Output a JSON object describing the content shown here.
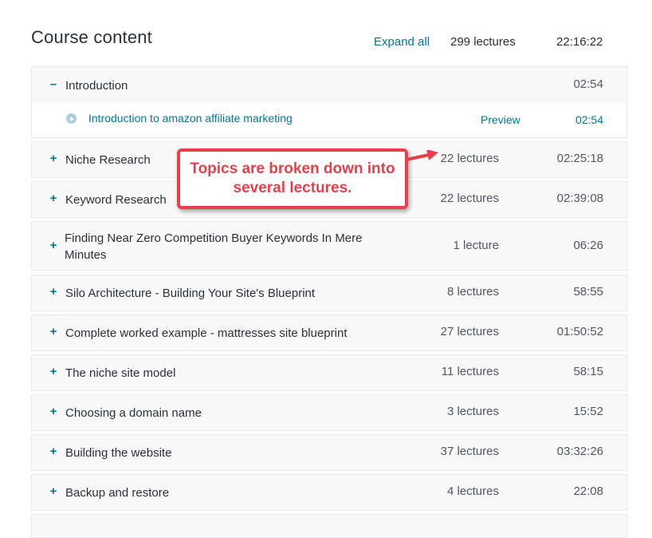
{
  "header": {
    "title": "Course content",
    "expand_all": "Expand all",
    "lecture_count": "299 lectures",
    "total_duration": "22:16:22"
  },
  "sections": [
    {
      "toggle": "–",
      "title": "Introduction",
      "count": "",
      "duration": "02:54"
    },
    {
      "toggle": "+",
      "title": "Niche Research",
      "count": "22 lectures",
      "duration": "02:25:18"
    },
    {
      "toggle": "+",
      "title": "Keyword Research",
      "count": "22 lectures",
      "duration": "02:39:08"
    },
    {
      "toggle": "+",
      "title": "Finding Near Zero Competition Buyer Keywords In Mere Minutes",
      "count": "1 lecture",
      "duration": "06:26"
    },
    {
      "toggle": "+",
      "title": "Silo Architecture - Building Your Site's Blueprint",
      "count": "8 lectures",
      "duration": "58:55"
    },
    {
      "toggle": "+",
      "title": "Complete worked example - mattresses site blueprint",
      "count": "27 lectures",
      "duration": "01:50:52"
    },
    {
      "toggle": "+",
      "title": "The niche site model",
      "count": "11 lectures",
      "duration": "58:15"
    },
    {
      "toggle": "+",
      "title": "Choosing a domain name",
      "count": "3 lectures",
      "duration": "15:52"
    },
    {
      "toggle": "+",
      "title": "Building the website",
      "count": "37 lectures",
      "duration": "03:32:26"
    },
    {
      "toggle": "+",
      "title": "Backup and restore",
      "count": "4 lectures",
      "duration": "22:08"
    }
  ],
  "intro_lecture": {
    "title": "Introduction to amazon affiliate marketing",
    "preview": "Preview",
    "duration": "02:54"
  },
  "callout": {
    "text": "Topics are broken down into several lectures."
  },
  "colors": {
    "link": "#007791",
    "callout": "#e8404a",
    "section_bg": "#f9f9f9"
  }
}
